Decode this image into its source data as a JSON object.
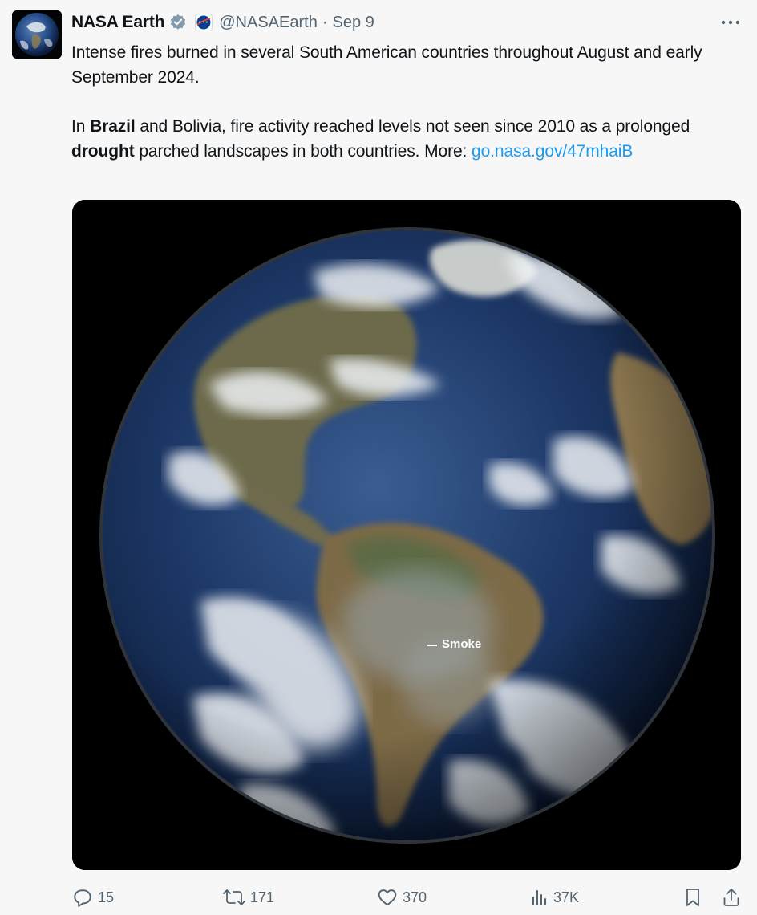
{
  "post": {
    "author": {
      "name": "NASA Earth",
      "handle": "@NASAEarth",
      "verified_icon": "verified-badge-icon",
      "affiliate_icon": "nasa-meatball-icon"
    },
    "separator": "·",
    "date": "Sep 9",
    "text": {
      "p1": "Intense fires burned in several South American countries throughout August and early September 2024.",
      "p2_a": "In ",
      "p2_bold1": "Brazil",
      "p2_b": " and Bolivia, fire activity reached levels not seen since 2010 as a prolonged ",
      "p2_bold2": "drought",
      "p2_c": " parched landscapes in both countries. More: ",
      "link": "go.nasa.gov/47mhaiB"
    },
    "media": {
      "annotation": "Smoke"
    }
  },
  "actions": {
    "replies": "15",
    "reposts": "171",
    "likes": "370",
    "views": "37K"
  },
  "colors": {
    "link": "#1d9bf0",
    "secondary_text": "#536471",
    "verified_badge": "#829aab",
    "background": "#f7f7f7"
  }
}
